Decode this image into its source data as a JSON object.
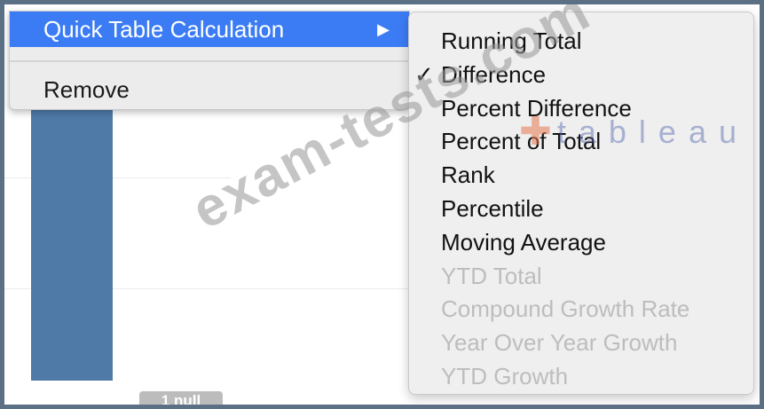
{
  "context_menu": {
    "highlighted_label": "Quick Table Calculation",
    "submenu_arrow": "▶",
    "remove_label": "Remove"
  },
  "submenu": {
    "items": [
      {
        "label": "Running Total",
        "enabled": true,
        "checked": false
      },
      {
        "label": "Difference",
        "enabled": true,
        "checked": true
      },
      {
        "label": "Percent Difference",
        "enabled": true,
        "checked": false
      },
      {
        "label": "Percent of Total",
        "enabled": true,
        "checked": false
      },
      {
        "label": "Rank",
        "enabled": true,
        "checked": false
      },
      {
        "label": "Percentile",
        "enabled": true,
        "checked": false
      },
      {
        "label": "Moving Average",
        "enabled": true,
        "checked": false
      },
      {
        "label": "YTD Total",
        "enabled": false,
        "checked": false
      },
      {
        "label": "Compound Growth Rate",
        "enabled": false,
        "checked": false
      },
      {
        "label": "Year Over Year Growth",
        "enabled": false,
        "checked": false
      },
      {
        "label": "YTD Growth",
        "enabled": false,
        "checked": false
      }
    ],
    "check_mark": "✓"
  },
  "background": {
    "null_pill_label": "1 null"
  },
  "watermarks": {
    "exam_text": "exam-tests.com",
    "brand_text": "tableau"
  },
  "colors": {
    "highlight": "#3b7cf5",
    "bar": "#4f7aa8",
    "disabled_text": "#bdbdbd"
  }
}
